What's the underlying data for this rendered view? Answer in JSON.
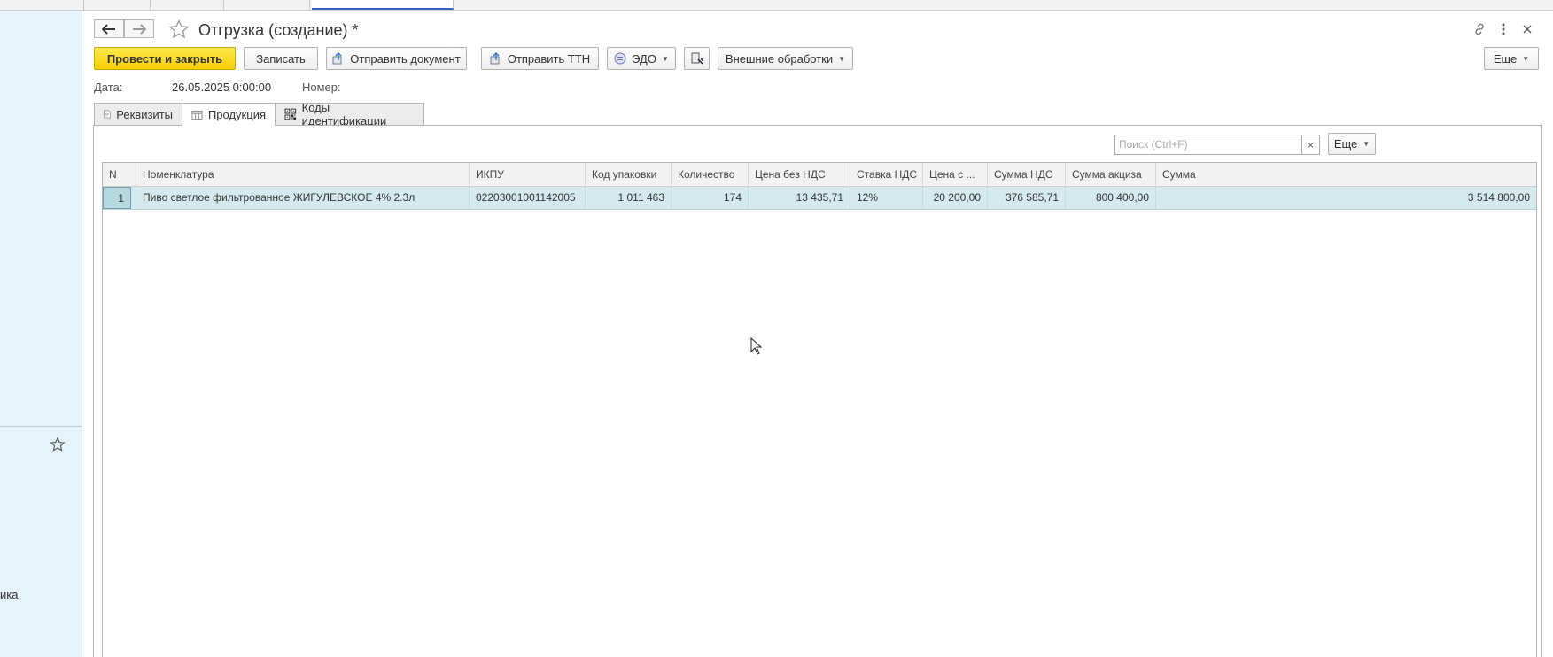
{
  "sidebar": {
    "fragment_text": "ика"
  },
  "nav": {
    "back_icon": "arrow-left-icon",
    "forward_icon": "arrow-right-icon"
  },
  "form": {
    "title": "Отгрузка (создание) *"
  },
  "toolbar": {
    "post_close": "Провести и закрыть",
    "save": "Записать",
    "send_document": "Отправить документ",
    "send_ttn": "Отправить ТТН",
    "edo": "ЭДО",
    "external": "Внешние обработки",
    "more": "Еще"
  },
  "header_fields": {
    "date_label": "Дата:",
    "date_value": "26.05.2025 0:00:00",
    "number_label": "Номер:"
  },
  "tabs": [
    {
      "label": "Реквизиты"
    },
    {
      "label": "Продукция"
    },
    {
      "label": "Коды идентификации"
    }
  ],
  "panel": {
    "search_placeholder": "Поиск (Ctrl+F)",
    "clear": "×",
    "more": "Еще"
  },
  "table": {
    "columns": [
      "N",
      "Номенклатура",
      "ИКПУ",
      "Код упаковки",
      "Количество",
      "Цена без НДС",
      "Ставка НДС",
      "Цена с ...",
      "Сумма НДС",
      "Сумма акциза",
      "Сумма"
    ],
    "rows": [
      [
        "1",
        "Пиво светлое фильтрованное ЖИГУЛЕВСКОЕ 4% 2.3л",
        "02203001001142005",
        "1 011 463",
        "174",
        "13 435,71",
        "12%",
        "20 200,00",
        "376 585,71",
        "800 400,00",
        "3 514 800,00"
      ]
    ]
  },
  "colors": {
    "primary_button": "#f5d000",
    "sidebar_bg": "#e6f3fb",
    "selected_row": "#d4eaee"
  }
}
